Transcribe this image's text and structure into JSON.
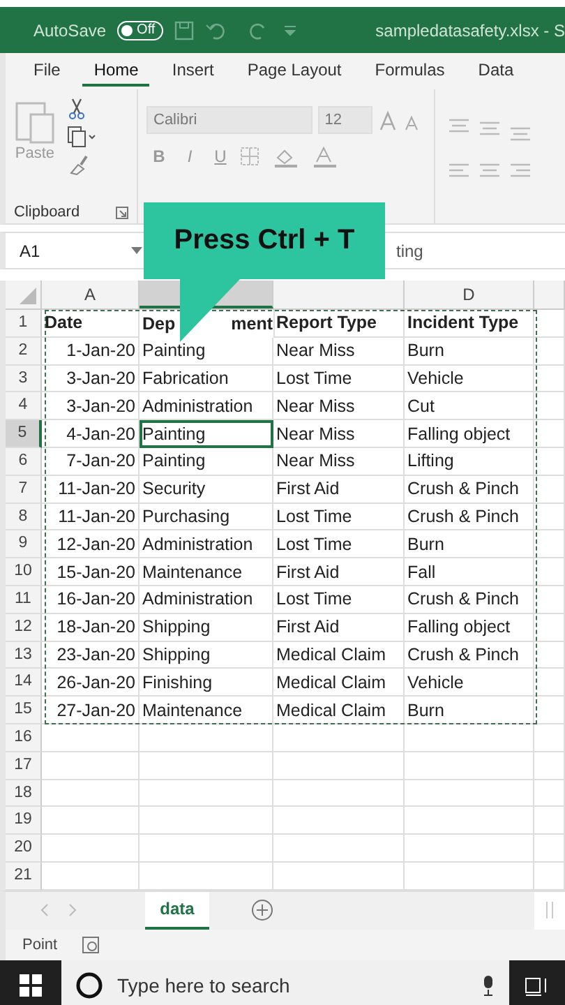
{
  "title_bar": {
    "autosave_label": "AutoSave",
    "autosave": {
      "on": false,
      "label": "Off"
    },
    "file_name": "sampledatasafety.xlsx  -  S"
  },
  "ribbon_tabs": [
    {
      "label": "File",
      "selected": false
    },
    {
      "label": "Home",
      "selected": true
    },
    {
      "label": "Insert",
      "selected": false
    },
    {
      "label": "Page Layout",
      "selected": false
    },
    {
      "label": "Formulas",
      "selected": false
    },
    {
      "label": "Data",
      "selected": false
    }
  ],
  "ribbon": {
    "paste_label": "Paste",
    "clipboard_label": "Clipboard",
    "font_name": "Calibri",
    "font_size": "12",
    "bold": "B",
    "italic": "I",
    "underline": "U"
  },
  "formula_bar": {
    "name_box": "A1",
    "content": "ting"
  },
  "callout": {
    "text": "Press Ctrl + T"
  },
  "column_headers": [
    {
      "label": "A",
      "selected": false
    },
    {
      "selected": true
    },
    {
      "selected": false
    },
    {
      "label": "D",
      "selected": false
    },
    {
      "selected": false
    }
  ],
  "rows": [
    {
      "number": "1",
      "kind": "header",
      "selected": false,
      "cells": [
        "Date",
        [
          "Dep",
          "ment"
        ],
        "Report Type",
        "Incident Type"
      ]
    },
    {
      "number": "2",
      "kind": "data",
      "selected": false,
      "cells": [
        "1-Jan-20",
        "Painting",
        "Near Miss",
        "Burn"
      ]
    },
    {
      "number": "3",
      "kind": "data",
      "selected": false,
      "cells": [
        "3-Jan-20",
        "Fabrication",
        "Lost Time",
        "Vehicle"
      ]
    },
    {
      "number": "4",
      "kind": "data",
      "selected": false,
      "cells": [
        "3-Jan-20",
        "Administration",
        "Near Miss",
        "Cut"
      ]
    },
    {
      "number": "5",
      "kind": "data",
      "selected": true,
      "cells": [
        "4-Jan-20",
        "Painting",
        "Near Miss",
        "Falling object"
      ]
    },
    {
      "number": "6",
      "kind": "data",
      "selected": false,
      "cells": [
        "7-Jan-20",
        "Painting",
        "Near Miss",
        "Lifting"
      ]
    },
    {
      "number": "7",
      "kind": "data",
      "selected": false,
      "cells": [
        "11-Jan-20",
        "Security",
        "First Aid",
        "Crush & Pinch"
      ]
    },
    {
      "number": "8",
      "kind": "data",
      "selected": false,
      "cells": [
        "11-Jan-20",
        "Purchasing",
        "Lost Time",
        "Crush & Pinch"
      ]
    },
    {
      "number": "9",
      "kind": "data",
      "selected": false,
      "cells": [
        "12-Jan-20",
        "Administration",
        "Lost Time",
        "Burn"
      ]
    },
    {
      "number": "10",
      "kind": "data",
      "selected": false,
      "cells": [
        "15-Jan-20",
        "Maintenance",
        "First Aid",
        "Fall"
      ]
    },
    {
      "number": "11",
      "kind": "data",
      "selected": false,
      "cells": [
        "16-Jan-20",
        "Administration",
        "Lost Time",
        "Crush & Pinch"
      ]
    },
    {
      "number": "12",
      "kind": "data",
      "selected": false,
      "cells": [
        "18-Jan-20",
        "Shipping",
        "First Aid",
        "Falling object"
      ]
    },
    {
      "number": "13",
      "kind": "data",
      "selected": false,
      "cells": [
        "23-Jan-20",
        "Shipping",
        "Medical Claim",
        "Crush & Pinch"
      ]
    },
    {
      "number": "14",
      "kind": "data",
      "selected": false,
      "cells": [
        "26-Jan-20",
        "Finishing",
        "Medical Claim",
        "Vehicle"
      ]
    },
    {
      "number": "15",
      "kind": "data",
      "selected": false,
      "cells": [
        "27-Jan-20",
        "Maintenance",
        "Medical Claim",
        "Burn"
      ]
    },
    {
      "number": "16",
      "kind": "empty",
      "selected": false,
      "cells": []
    },
    {
      "number": "17",
      "kind": "empty",
      "selected": false,
      "cells": []
    },
    {
      "number": "18",
      "kind": "empty",
      "selected": false,
      "cells": []
    },
    {
      "number": "19",
      "kind": "empty",
      "selected": false,
      "cells": []
    },
    {
      "number": "20",
      "kind": "empty",
      "selected": false,
      "cells": []
    },
    {
      "number": "21",
      "kind": "empty",
      "selected": false,
      "cells": []
    }
  ],
  "sheet_tabs": [
    {
      "label": "data",
      "selected": true
    }
  ],
  "status_bar": {
    "mode": "Point"
  },
  "taskbar": {
    "search_placeholder": "Type here to search"
  }
}
